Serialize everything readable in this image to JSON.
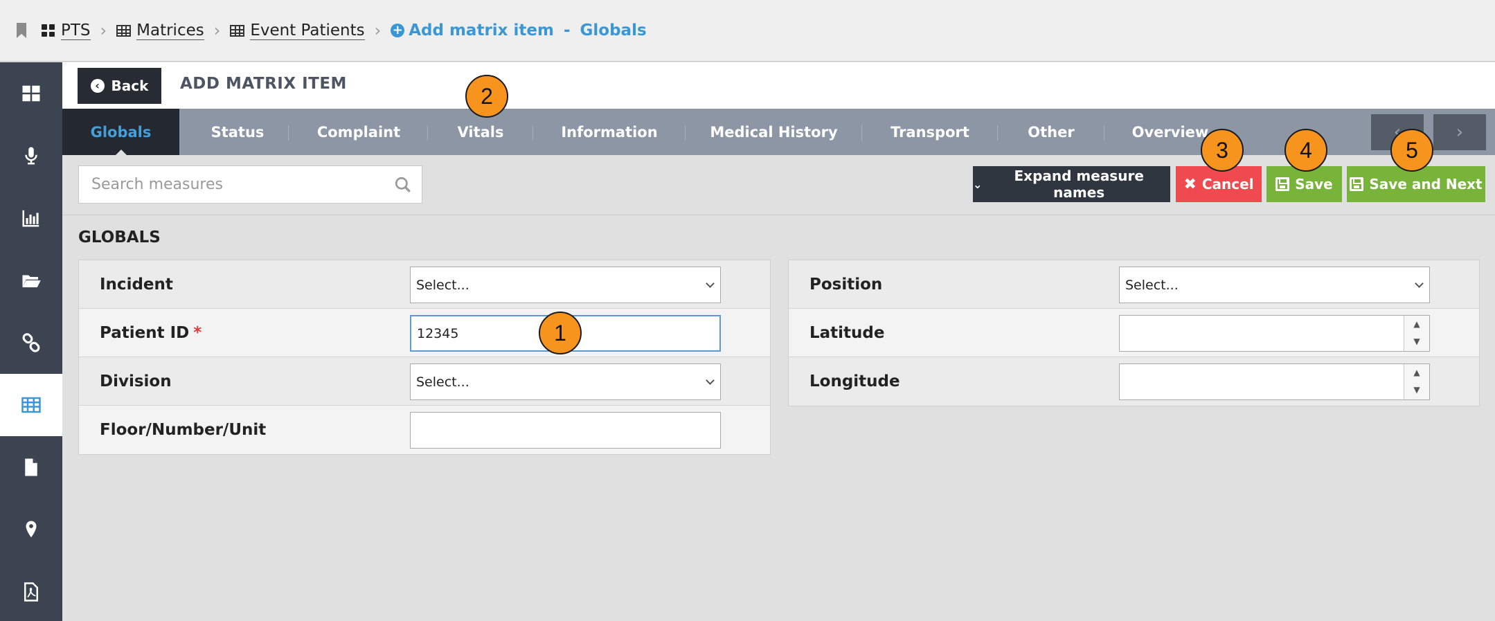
{
  "breadcrumb": {
    "items": [
      "PTS",
      "Matrices",
      "Event Patients"
    ],
    "active_label": "Add matrix item",
    "active_sep": "-",
    "active_section": "Globals"
  },
  "sidebar": {
    "icons": [
      "dashboard-icon",
      "microphone-icon",
      "bar-chart-icon",
      "folder-open-icon",
      "link-icon",
      "table-icon",
      "document-icon",
      "map-marker-icon",
      "pdf-icon"
    ],
    "active_index": 5
  },
  "header": {
    "back_label": "Back",
    "title": "ADD MATRIX ITEM"
  },
  "tabs": [
    "Globals",
    "Status",
    "Complaint",
    "Vitals",
    "Information",
    "Medical History",
    "Transport",
    "Other",
    "Overview"
  ],
  "toolbar": {
    "search_placeholder": "Search measures",
    "expand_label": "Expand measure names",
    "cancel_label": "Cancel",
    "save_label": "Save",
    "save_next_label": "Save and Next"
  },
  "section": {
    "title": "GLOBALS",
    "left_fields": [
      {
        "label": "Incident",
        "type": "select",
        "value": "Select..."
      },
      {
        "label": "Patient ID",
        "type": "text",
        "value": "12345",
        "required": true
      },
      {
        "label": "Division",
        "type": "select",
        "value": "Select..."
      },
      {
        "label": "Floor/Number/Unit",
        "type": "text",
        "value": ""
      }
    ],
    "right_fields": [
      {
        "label": "Position",
        "type": "select",
        "value": "Select..."
      },
      {
        "label": "Latitude",
        "type": "number",
        "value": ""
      },
      {
        "label": "Longitude",
        "type": "number",
        "value": ""
      }
    ],
    "required_mark": "*"
  },
  "callouts": [
    "1",
    "2",
    "3",
    "4",
    "5"
  ],
  "colors": {
    "accent": "#3b97d3",
    "sidebar": "#3b4450",
    "tabs": "#8c96a5",
    "cancel": "#ef4a4f",
    "save": "#78b43a",
    "callout": "#f7941d"
  }
}
